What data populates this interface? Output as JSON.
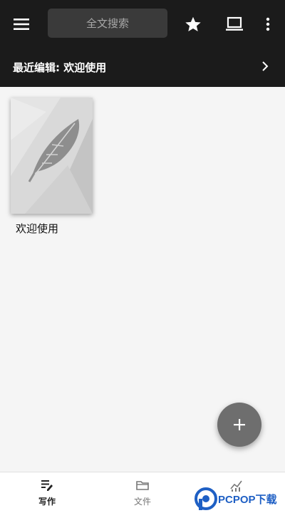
{
  "topbar": {
    "search_placeholder": "全文搜索",
    "icons": {
      "menu": "menu-icon",
      "star": "star-icon",
      "laptop": "laptop-icon",
      "more": "more-vert-icon"
    },
    "background_color": "#1b1b1b"
  },
  "recent": {
    "label": "最近编辑: 欢迎使用",
    "chevron_icon": "chevron-right-icon"
  },
  "documents": [
    {
      "title": "欢迎使用",
      "icon": "feather-icon"
    }
  ],
  "fab": {
    "icon": "plus-icon",
    "color": "#6e6e6e"
  },
  "bottom_nav": {
    "items": [
      {
        "label": "写作",
        "icon": "write-icon",
        "active": true
      },
      {
        "label": "文件",
        "icon": "folder-icon",
        "active": false
      },
      {
        "label": "",
        "icon": "chart-icon",
        "active": false
      }
    ]
  },
  "watermark": {
    "text": "PCPOP下载"
  }
}
